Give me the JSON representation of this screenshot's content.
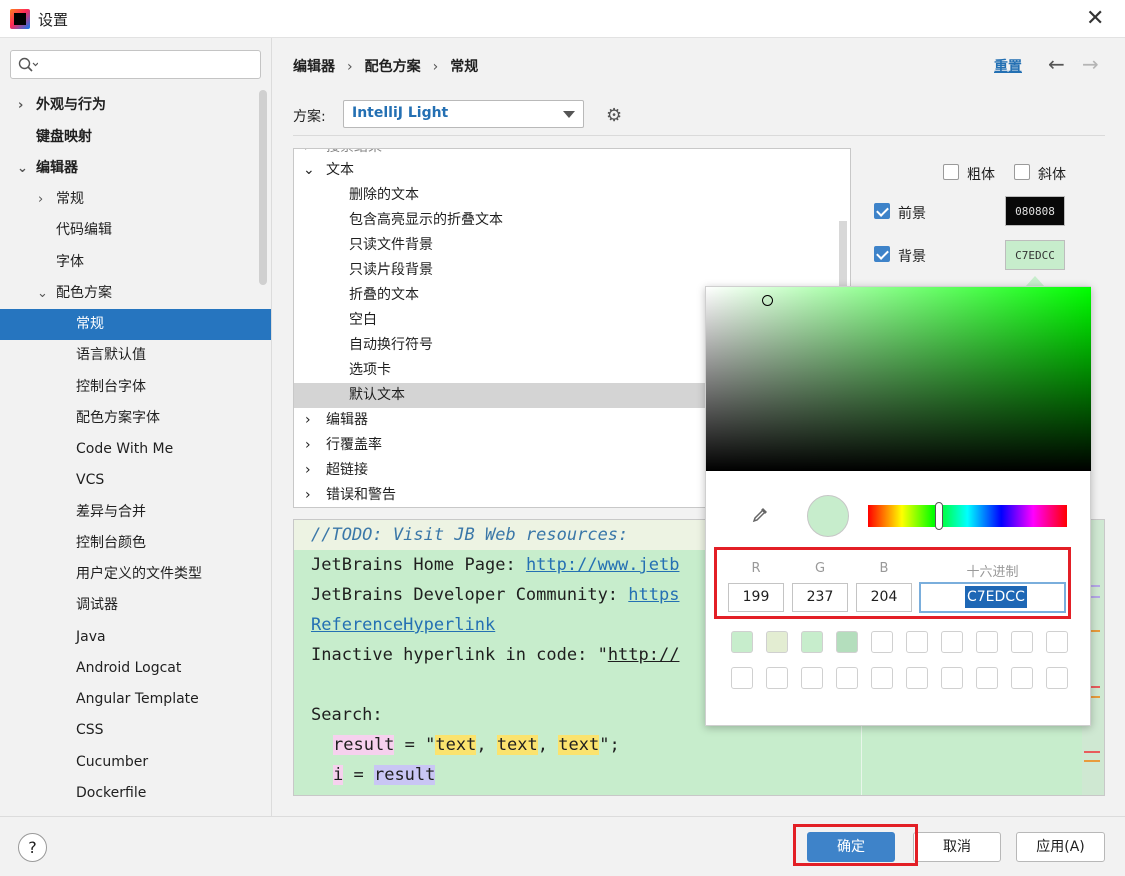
{
  "window": {
    "title": "设置"
  },
  "sidebar": {
    "items": [
      {
        "label": "外观与行为"
      },
      {
        "label": "键盘映射"
      },
      {
        "label": "编辑器"
      },
      {
        "label": "常规"
      },
      {
        "label": "代码编辑"
      },
      {
        "label": "字体"
      },
      {
        "label": "配色方案"
      },
      {
        "label": "常规"
      },
      {
        "label": "语言默认值"
      },
      {
        "label": "控制台字体"
      },
      {
        "label": "配色方案字体"
      },
      {
        "label": "Code With Me"
      },
      {
        "label": "VCS"
      },
      {
        "label": "差异与合并"
      },
      {
        "label": "控制台颜色"
      },
      {
        "label": "用户定义的文件类型"
      },
      {
        "label": "调试器"
      },
      {
        "label": "Java"
      },
      {
        "label": "Android Logcat"
      },
      {
        "label": "Angular Template"
      },
      {
        "label": "CSS"
      },
      {
        "label": "Cucumber"
      },
      {
        "label": "Dockerfile"
      }
    ]
  },
  "header": {
    "breadcrumb": [
      "编辑器",
      "配色方案",
      "常规"
    ],
    "breadcrumb_sep": "›",
    "reset_label": "重置"
  },
  "scheme": {
    "label": "方案:",
    "value": "IntelliJ Light"
  },
  "tree": {
    "partial_top": "搜索结果",
    "group_text": "文本",
    "text_items": [
      "删除的文本",
      "包含高亮显示的折叠文本",
      "只读文件背景",
      "只读片段背景",
      "折叠的文本",
      "空白",
      "自动换行符号",
      "选项卡",
      "默认文本"
    ],
    "other_groups": [
      "编辑器",
      "行覆盖率",
      "超链接",
      "错误和警告"
    ]
  },
  "options": {
    "bold_label": "粗体",
    "italic_label": "斜体",
    "foreground_label": "前景",
    "foreground_value": "080808",
    "background_label": "背景",
    "background_value": "C7EDCC"
  },
  "preview": {
    "todo": "//TODO: Visit JB Web resources:",
    "home_prefix": "JetBrains Home Page: ",
    "home_link": "http://www.jetb",
    "dev_prefix": "JetBrains Developer Community: ",
    "dev_link": "https",
    "ref_link": "ReferenceHyperlink",
    "inactive_prefix": "Inactive hyperlink in code: \"",
    "inactive_link": "http://",
    "search": "Search:",
    "result_kw": "result",
    "eq1": " = \"",
    "text1": "text",
    "comma1": ", ",
    "text2": "text",
    "comma2": ", ",
    "text3": "text",
    "end1": "\";",
    "i_var": "i",
    "eq2": " = ",
    "result2": "result"
  },
  "picker": {
    "r_label": "R",
    "g_label": "G",
    "b_label": "B",
    "hex_label": "十六进制",
    "r": "199",
    "g": "237",
    "b": "204",
    "hex": "C7EDCC"
  },
  "colors": {
    "selected_bg": "#C7EDCC",
    "accent": "#3E83C9",
    "recent_swatches": [
      "#C7EDCC",
      "#E3EDD2",
      "#C7EDCC",
      "#B4DEBD"
    ]
  },
  "footer": {
    "help": "?",
    "ok_label": "确定",
    "cancel_label": "取消",
    "apply_label": "应用(A)"
  }
}
